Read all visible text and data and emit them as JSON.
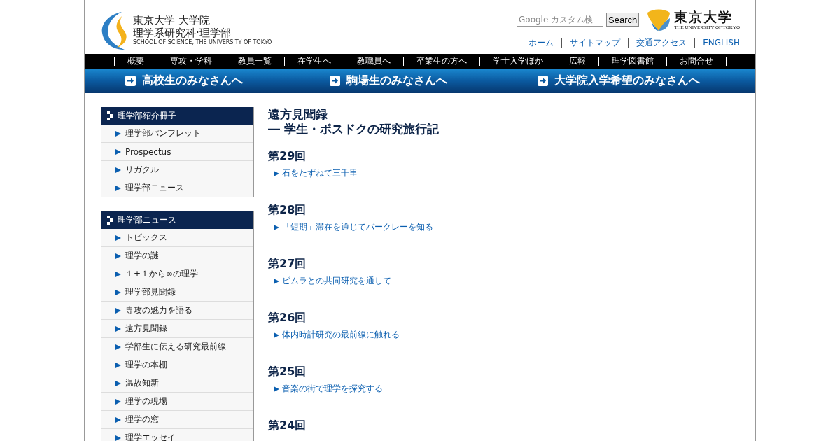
{
  "header": {
    "school_logo": {
      "line_1": "東京大学 大学院",
      "line_2": "理学系研究科·理学部",
      "line_3": "SCHOOL OF SCIENCE, THE UNIVERSITY OF TOKYO"
    },
    "search": {
      "placeholder": "Google カスタム検",
      "button": "Search"
    },
    "university_logo": {
      "name": "東京大学",
      "subtitle": "THE UNIVERSITY OF TOKYO"
    },
    "utility_links": [
      "ホーム",
      "サイトマップ",
      "交通アクセス",
      "ENGLISH"
    ]
  },
  "main_nav": [
    "概要",
    "専攻・学科",
    "教員一覧",
    "在学生へ",
    "教職員へ",
    "卒業生の方へ",
    "学士入学ほか",
    "広報",
    "理学図書館",
    "お問合せ"
  ],
  "banner_links": [
    "高校生のみなさんへ",
    "駒場生のみなさんへ",
    "大学院入学希望のみなさんへ"
  ],
  "sidebar": [
    {
      "title": "理学部紹介冊子",
      "items": [
        "理学部パンフレット",
        "Prospectus",
        "リガクル",
        "理学部ニュース"
      ]
    },
    {
      "title": "理学部ニュース",
      "items": [
        "トピックス",
        "理学の謎",
        "１+１から∞の理学",
        "理学部見聞録",
        "専攻の魅力を語る",
        "遠方見聞録",
        "学部生に伝える研究最前線",
        "理学の本棚",
        "温故知新",
        "理学の現場",
        "理学の窓",
        "理学エッセイ"
      ]
    }
  ],
  "content": {
    "title_line_1": "遠方見聞録",
    "title_line_2": "― 学生・ポスドクの研究旅行記",
    "issues": [
      {
        "heading": "第29回",
        "links": [
          "石をたずねて三千里"
        ]
      },
      {
        "heading": "第28回",
        "links": [
          "「短期」滞在を通じてバークレーを知る"
        ]
      },
      {
        "heading": "第27回",
        "links": [
          "ビムラとの共同研究を通して"
        ]
      },
      {
        "heading": "第26回",
        "links": [
          "体内時計研究の最前線に触れる"
        ]
      },
      {
        "heading": "第25回",
        "links": [
          "音楽の街で理学を探究する"
        ]
      },
      {
        "heading": "第24回"
      }
    ]
  }
}
